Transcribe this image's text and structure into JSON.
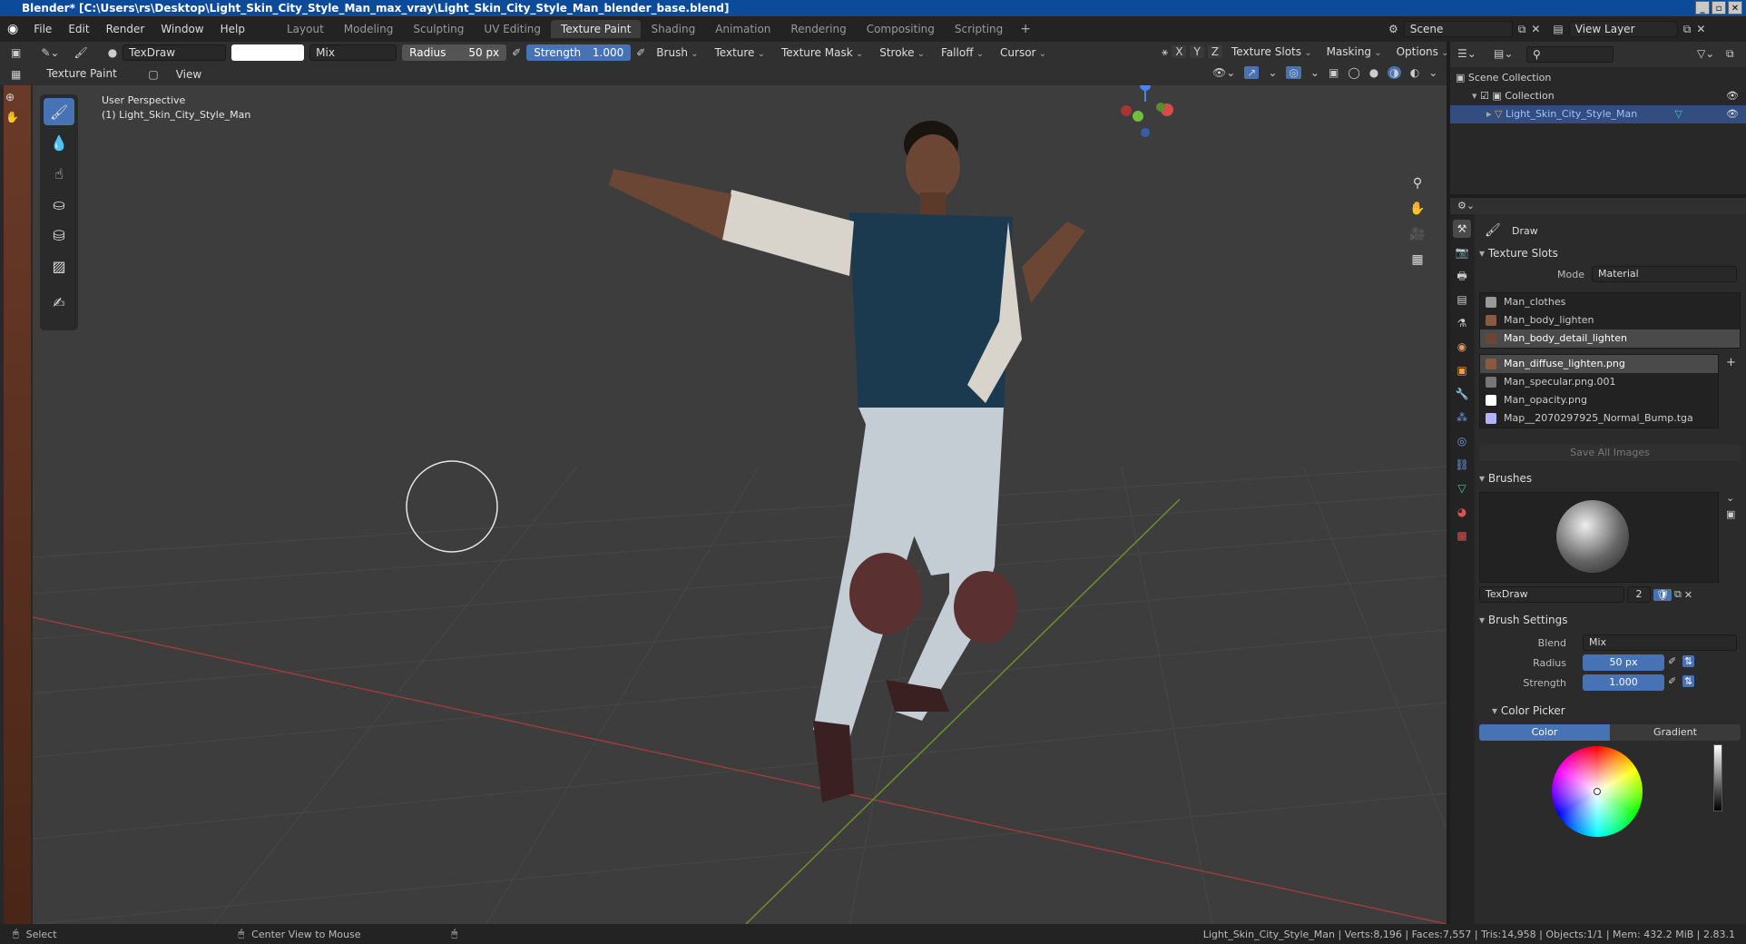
{
  "window": {
    "title": "Blender* [C:\\Users\\rs\\Desktop\\Light_Skin_City_Style_Man_max_vray\\Light_Skin_City_Style_Man_blender_base.blend]"
  },
  "menu": [
    "File",
    "Edit",
    "Render",
    "Window",
    "Help"
  ],
  "workspaces": [
    "Layout",
    "Modeling",
    "Sculpting",
    "UV Editing",
    "Texture Paint",
    "Shading",
    "Animation",
    "Rendering",
    "Compositing",
    "Scripting"
  ],
  "active_workspace": "Texture Paint",
  "scene": {
    "scene_name": "Scene",
    "view_layer": "View Layer"
  },
  "tool_header": {
    "brush_name": "TexDraw",
    "blend": "Mix",
    "radius_label": "Radius",
    "radius_value": "50 px",
    "strength_label": "Strength",
    "strength_value": "1.000",
    "dropdowns": [
      "Brush",
      "Texture",
      "Texture Mask",
      "Stroke",
      "Falloff",
      "Cursor"
    ],
    "axes": [
      "X",
      "Y",
      "Z"
    ],
    "right_dropdowns": [
      "Texture Slots",
      "Masking",
      "Options"
    ]
  },
  "tool_header2": {
    "mode": "Texture Paint",
    "view": "View"
  },
  "viewport": {
    "perspective": "User Perspective",
    "object_label": "(1) Light_Skin_City_Style_Man"
  },
  "outliner": {
    "scene_collection": "Scene Collection",
    "collection": "Collection",
    "object": "Light_Skin_City_Style_Man"
  },
  "properties": {
    "tool_name": "Draw",
    "texture_slots_title": "Texture Slots",
    "mode_label": "Mode",
    "mode_value": "Material",
    "materials": [
      "Man_clothes",
      "Man_body_lighten",
      "Man_body_detail_lighten"
    ],
    "active_material_index": 2,
    "images": [
      "Man_diffuse_lighten.png",
      "Man_specular.png.001",
      "Man_opacity.png",
      "Map__2070297925_Normal_Bump.tga"
    ],
    "active_image_index": 0,
    "save_all_images": "Save All Images",
    "brushes_title": "Brushes",
    "brush_name": "TexDraw",
    "brush_users": "2",
    "brush_settings_title": "Brush Settings",
    "blend_label": "Blend",
    "blend_value": "Mix",
    "radius_label": "Radius",
    "radius_value": "50 px",
    "strength_label": "Strength",
    "strength_value": "1.000",
    "color_picker_title": "Color Picker",
    "color_tab": "Color",
    "gradient_tab": "Gradient"
  },
  "statusbar": {
    "left": "Select",
    "middle": "Center View to Mouse",
    "right": "Light_Skin_City_Style_Man | Verts:8,196 | Faces:7,557 | Tris:14,958 | Objects:1/1 | Mem: 432.2 MiB | 2.83.1"
  },
  "colors": {
    "accent": "#4772b3",
    "title_bar": "#0c4b9a",
    "viewport_bg": "#3d3d3d"
  }
}
